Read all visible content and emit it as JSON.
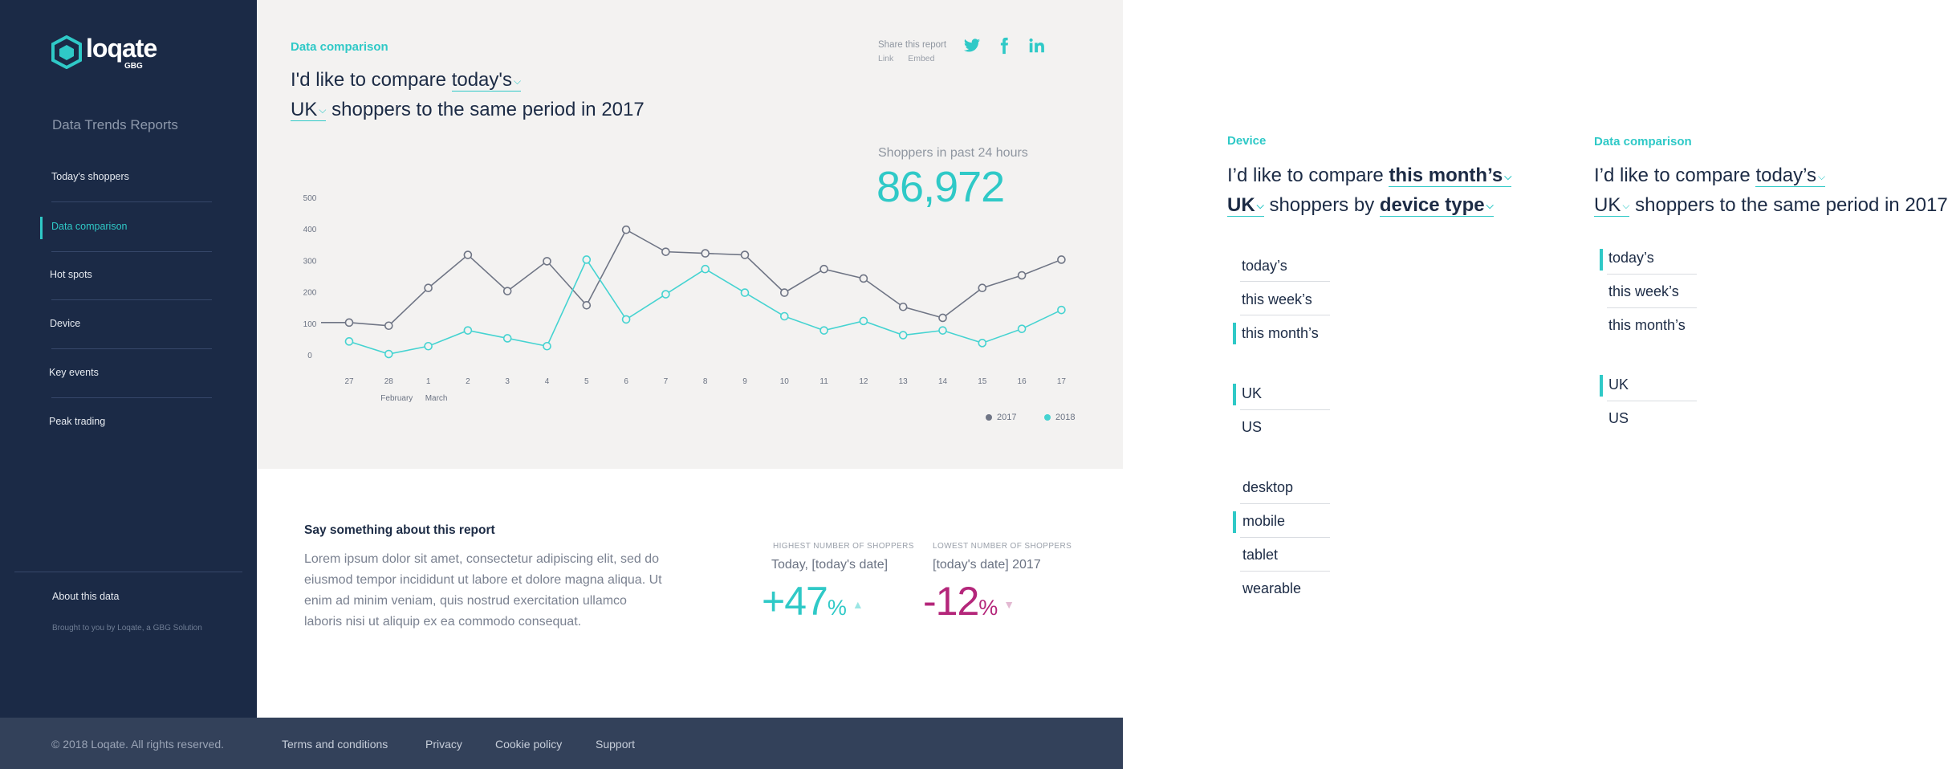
{
  "sidebar": {
    "logo_word": "loqate",
    "logo_sub": "GBG",
    "title": "Data Trends Reports",
    "items": [
      {
        "label": "Today's shoppers",
        "active": false
      },
      {
        "label": "Data comparison",
        "active": true
      },
      {
        "label": "Hot spots",
        "active": false
      },
      {
        "label": "Device",
        "active": false
      },
      {
        "label": "Key events",
        "active": false
      },
      {
        "label": "Peak trading",
        "active": false
      }
    ],
    "about": "About this data",
    "brought": "Brought to you by Loqate, a GBG Solution"
  },
  "main": {
    "section_label": "Data comparison",
    "sentence": {
      "part1": "I'd like to compare",
      "period": "today's",
      "region": "UK",
      "part2": "shoppers to the same period in 2017"
    },
    "share": {
      "title": "Share this report",
      "link": "Link",
      "embed": "Embed",
      "icons": [
        "twitter-icon",
        "facebook-icon",
        "linkedin-icon"
      ]
    },
    "kpi": {
      "label": "Shoppers in past 24 hours",
      "value": "86,972"
    }
  },
  "chart_data": {
    "type": "line",
    "x": [
      "27",
      "28",
      "1",
      "2",
      "3",
      "4",
      "5",
      "6",
      "7",
      "8",
      "9",
      "10",
      "11",
      "12",
      "13",
      "14",
      "15",
      "16",
      "17"
    ],
    "month_labels": [
      "February",
      "March"
    ],
    "ylim": [
      0,
      500
    ],
    "yticks": [
      0,
      100,
      200,
      300,
      400,
      500
    ],
    "grid": false,
    "legend_position": "bottom-right",
    "series": [
      {
        "name": "2017",
        "color": "#6f7585",
        "values": [
          105,
          95,
          215,
          320,
          205,
          300,
          160,
          400,
          330,
          325,
          320,
          200,
          275,
          245,
          155,
          120,
          215,
          255,
          305
        ]
      },
      {
        "name": "2018",
        "color": "#45d3d1",
        "values": [
          45,
          5,
          30,
          80,
          55,
          30,
          305,
          115,
          195,
          275,
          200,
          125,
          80,
          110,
          65,
          80,
          40,
          85,
          145
        ]
      }
    ]
  },
  "about": {
    "title": "Say something about this report",
    "text": "Lorem ipsum dolor sit amet, consectetur adipiscing elit, sed do eiusmod tempor incididunt ut labore et dolore magna aliqua. Ut enim ad minim veniam, quis nostrud exercitation ullamco laboris nisi ut aliquip ex ea commodo consequat."
  },
  "stats": {
    "highest": {
      "head": "HIGHEST NUMBER OF SHOPPERS",
      "sub": "Today, [today's date]",
      "value": "+47",
      "unit": "%",
      "arrow": "▲",
      "color": "#2fc9c7"
    },
    "lowest": {
      "head": "LOWEST NUMBER OF SHOPPERS",
      "sub": "[today's date] 2017",
      "value": "-12",
      "unit": "%",
      "arrow": "▼",
      "color": "#b4267a"
    }
  },
  "footer": {
    "copyright": "© 2018 Loqate. All rights reserved.",
    "links": [
      "Terms and conditions",
      "Privacy",
      "Cookie policy",
      "Support"
    ]
  },
  "device_panel": {
    "label": "Device",
    "part1": "I’d like to compare",
    "period": "this month’s",
    "region": "UK",
    "part2": "shoppers by",
    "dimension": "device type",
    "period_options": [
      "today’s",
      "this week’s",
      "this month’s"
    ],
    "period_selected": 2,
    "region_options": [
      "UK",
      "US"
    ],
    "region_selected": 0,
    "device_options": [
      "desktop",
      "mobile",
      "tablet",
      "wearable"
    ],
    "device_selected": 1
  },
  "compare_panel": {
    "label": "Data comparison",
    "part1": "I’d like to compare",
    "period": "today’s",
    "region": "UK",
    "part2": "shoppers to the same period in 2017",
    "period_options": [
      "today’s",
      "this week’s",
      "this month’s"
    ],
    "period_selected": 0,
    "region_options": [
      "UK",
      "US"
    ],
    "region_selected": 0
  },
  "colors": {
    "accent": "#2fc9c7",
    "sidebar": "#1b2a46",
    "footer": "#33415a",
    "negative": "#b4267a"
  }
}
